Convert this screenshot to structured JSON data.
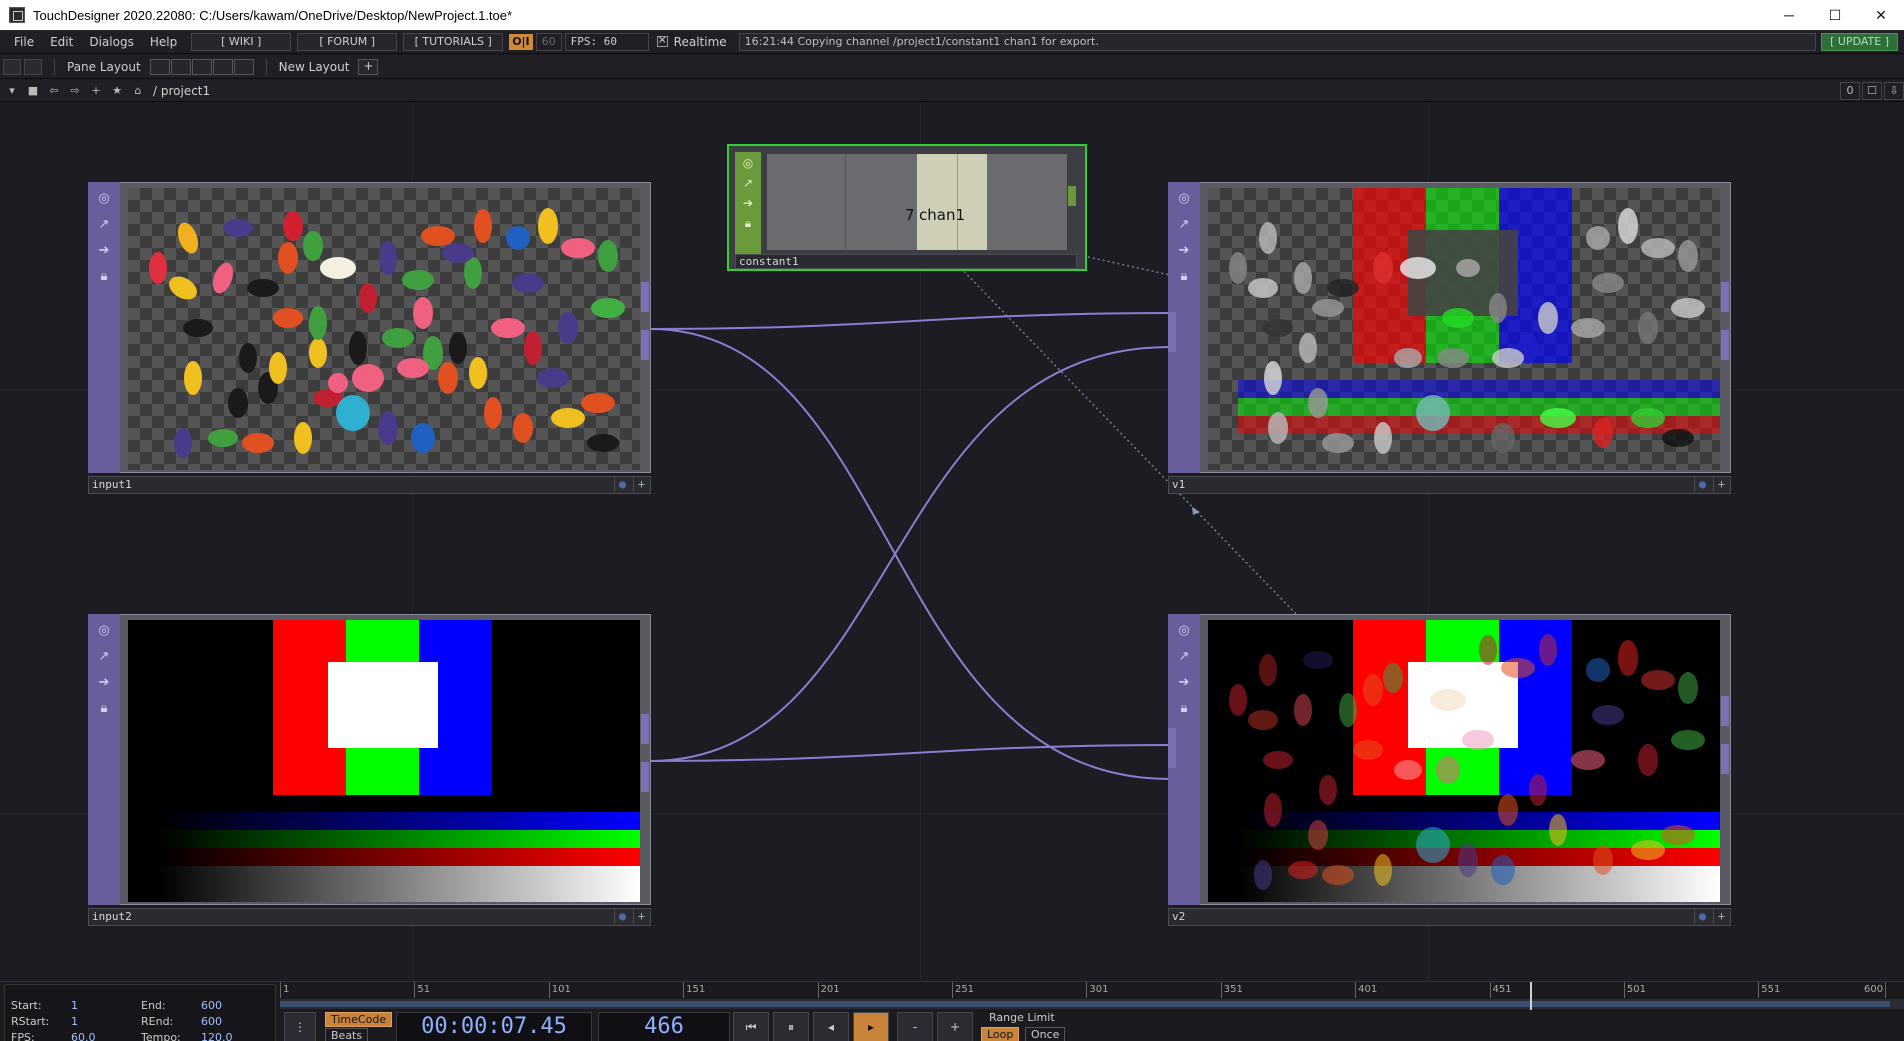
{
  "titlebar": {
    "title": "TouchDesigner 2020.22080: C:/Users/kawam/OneDrive/Desktop/NewProject.1.toe*",
    "minimize": "─",
    "maximize": "☐",
    "close": "✕"
  },
  "menubar": {
    "items": [
      "File",
      "Edit",
      "Dialogs",
      "Help"
    ],
    "wiki": "[ WIKI ]",
    "forum": "[ FORUM ]",
    "tutorials": "[ TUTORIALS ]",
    "oi": "O|I",
    "fps_target": "60",
    "fps": "FPS:  60",
    "realtime": "Realtime",
    "message": "16:21:44 Copying channel /project1/constant1 chan1 for export.",
    "update": "[ UPDATE ]"
  },
  "layoutbar": {
    "pane_layout": "Pane Layout",
    "new_layout": "New Layout",
    "add": "+"
  },
  "pathbar": {
    "path": "/ project1",
    "right_value": "0"
  },
  "nodes": {
    "input1": {
      "label": "input1",
      "type": "TOP"
    },
    "input2": {
      "label": "input2",
      "type": "TOP"
    },
    "constant1": {
      "label": "constant1",
      "type": "CHOP",
      "channel_value": "7",
      "channel_name": "chan1"
    },
    "v1": {
      "label": "v1",
      "type": "TOP"
    },
    "v2": {
      "label": "v2",
      "type": "TOP"
    }
  },
  "colors": {
    "top_accent": "#6a5d9c",
    "chop_accent": "#6a9a3c",
    "wire": "#8a7ed0",
    "selected": "#2fd02f"
  },
  "timeline": {
    "start_label": "Start:",
    "start": "1",
    "end_label": "End:",
    "end": "600",
    "rstart_label": "RStart:",
    "rstart": "1",
    "rend_label": "REnd:",
    "rend": "600",
    "fps_label": "FPS:",
    "fps": "60.0",
    "tempo_label": "Tempo:",
    "tempo": "120.0",
    "timecode_btn": "TimeCode",
    "beats_btn": "Beats",
    "timecode": "00:00:07.45",
    "frame": "466",
    "range_limit": "Range Limit",
    "loop": "Loop",
    "once": "Once",
    "ruler_ticks": [
      "1",
      "51",
      "101",
      "151",
      "201",
      "251",
      "301",
      "351",
      "401",
      "451",
      "501",
      "551",
      "600"
    ],
    "frame_start": 1,
    "frame_end": 600,
    "current_frame": 466
  }
}
